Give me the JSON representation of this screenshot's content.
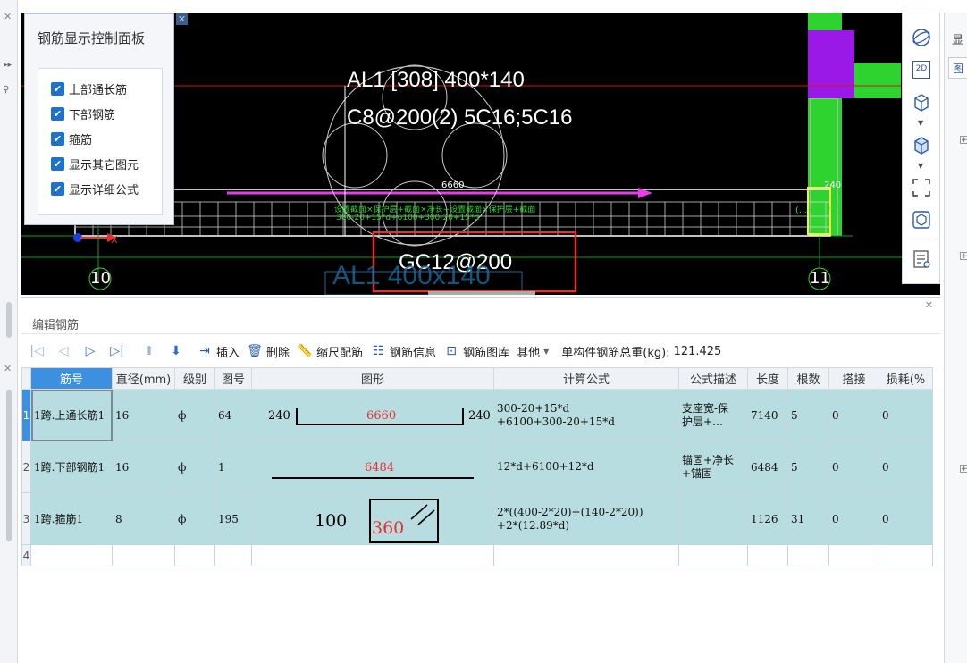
{
  "control_panel": {
    "title": "钢筋显示控制面板",
    "options": [
      {
        "label": "上部通长筋",
        "checked": true
      },
      {
        "label": "下部钢筋",
        "checked": true
      },
      {
        "label": "箍筋",
        "checked": true
      },
      {
        "label": "显示其它图元",
        "checked": true
      },
      {
        "label": "显示详细公式",
        "checked": true
      }
    ]
  },
  "viewport": {
    "beam_label_line1": "AL1 [308] 400*140",
    "beam_label_line2": "C8@200(2) 5C16;5C16",
    "highlight_text": "GC12@200",
    "dim_top": "6660",
    "dim_right": "240",
    "formula_overlay_1": "设置截面×保护层+截面×净长+设置截面×保护层+截面",
    "formula_overlay_2": "300-20+15*d+6100+300-20+15*d",
    "formula_overlay_right": "(...+15*d)",
    "axis_left": "10",
    "axis_right": "11",
    "ghost_label": "AL1 400x140",
    "colors": {
      "bg": "#000000",
      "magenta": "#e83ee8",
      "green": "#2fd32f",
      "purple": "#9b19e6",
      "red": "#e53030",
      "white": "#ffffff"
    }
  },
  "right_toolbar": {
    "icons": [
      "orbit-icon",
      "2d-view-icon",
      "box-wire-icon",
      "box-solid-icon",
      "selection-frame-icon",
      "cube-settings-icon",
      "report-icon"
    ],
    "label_2d": "2D"
  },
  "far_right": {
    "title": "显",
    "tab": "图"
  },
  "editor": {
    "title": "编辑钢筋",
    "toolbar": {
      "insert": "插入",
      "delete": "删除",
      "scale": "缩尺配筋",
      "info": "钢筋信息",
      "library": "钢筋图库",
      "other": "其他",
      "total_label": "单构件钢筋总重(kg):",
      "total_value": "121.425"
    },
    "columns": [
      "筋号",
      "直径(mm)",
      "级别",
      "图号",
      "图形",
      "计算公式",
      "公式描述",
      "长度",
      "根数",
      "搭接",
      "损耗(%"
    ],
    "rows": [
      {
        "num": "1",
        "name": "1跨.上通长筋1",
        "diameter": "16",
        "grade": "ф",
        "shape_no": "64",
        "shape": {
          "left": "240",
          "mid": "6660",
          "right": "240"
        },
        "formula_1": "300-20+15*d",
        "formula_2": "+6100+300-20+15*d",
        "desc_1": "支座宽-保",
        "desc_2": "护层+…",
        "length": "7140",
        "count": "5",
        "lap": "0",
        "loss": "0"
      },
      {
        "num": "2",
        "name": "1跨.下部钢筋1",
        "diameter": "16",
        "grade": "ф",
        "shape_no": "1",
        "shape": {
          "mid": "6484"
        },
        "formula_1": "12*d+6100+12*d",
        "formula_2": "",
        "desc_1": "锚固+净长",
        "desc_2": "+锚固",
        "length": "6484",
        "count": "5",
        "lap": "0",
        "loss": "0"
      },
      {
        "num": "3",
        "name": "1跨.箍筋1",
        "diameter": "8",
        "grade": "ф",
        "shape_no": "195",
        "shape": {
          "left": "100",
          "mid": "360"
        },
        "formula_1": "2*((400-2*20)+(140-2*20))",
        "formula_2": "+2*(12.89*d)",
        "desc_1": "",
        "desc_2": "",
        "length": "1126",
        "count": "31",
        "lap": "0",
        "loss": "0"
      },
      {
        "num": "4"
      }
    ]
  }
}
